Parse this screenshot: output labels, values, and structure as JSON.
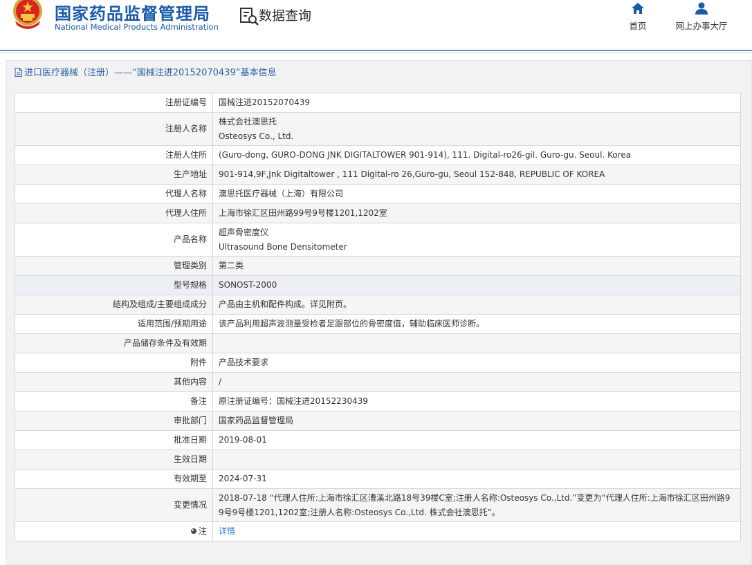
{
  "header": {
    "brand_cn": "国家药品监督管理局",
    "brand_en": "National Medical Products Administration",
    "section_label": "数据查询",
    "nav": [
      {
        "label": "首页",
        "icon": "home-icon"
      },
      {
        "label": "网上办事大厅",
        "icon": "user-icon"
      }
    ]
  },
  "panel": {
    "title": "进口医疗器械（注册）——“国械注进20152070439”基本信息"
  },
  "record": {
    "rows": [
      {
        "key": "注册证编号",
        "lines": [
          "国械注进20152070439"
        ]
      },
      {
        "key": "注册人名称",
        "lines": [
          "株式会社澳思托",
          "Osteosys Co., Ltd."
        ]
      },
      {
        "key": "注册人住所",
        "lines": [
          "(Guro-dong, GURO-DONG JNK DIGITALTOWER 901-914), 111. Digital-ro26-gil. Guro-gu. Seoul. Korea"
        ]
      },
      {
        "key": "生产地址",
        "lines": [
          "901-914,9F,Jnk Digitaltower , 111 Digital-ro 26,Guro-gu, Seoul 152-848, REPUBLIC OF KOREA"
        ]
      },
      {
        "key": "代理人名称",
        "lines": [
          "澳思托医疗器械（上海）有限公司"
        ]
      },
      {
        "key": "代理人住所",
        "lines": [
          "上海市徐汇区田州路99号9号楼1201,1202室"
        ]
      },
      {
        "key": "产品名称",
        "lines": [
          "超声骨密度仪",
          "Ultrasound Bone Densitometer"
        ]
      },
      {
        "key": "管理类别",
        "lines": [
          "第二类"
        ]
      },
      {
        "key": "型号规格",
        "lines": [
          "SONOST-2000"
        ]
      },
      {
        "key": "结构及组成/主要组成成分",
        "lines": [
          "产品由主机和配件构成。详见附页。"
        ]
      },
      {
        "key": "适用范围/预期用途",
        "lines": [
          "该产品利用超声波测量受检者足跟部位的骨密度值，辅助临床医师诊断。"
        ]
      },
      {
        "key": "产品储存条件及有效期",
        "lines": [
          ""
        ]
      },
      {
        "key": "附件",
        "lines": [
          "产品技术要求"
        ]
      },
      {
        "key": "其他内容",
        "lines": [
          "/"
        ]
      },
      {
        "key": "备注",
        "lines": [
          "原注册证编号：国械注进20152230439"
        ]
      },
      {
        "key": "审批部门",
        "lines": [
          "国家药品监督管理局"
        ]
      },
      {
        "key": "批准日期",
        "lines": [
          "2019-08-01"
        ]
      },
      {
        "key": "生效日期",
        "lines": [
          ""
        ]
      },
      {
        "key": "有效期至",
        "lines": [
          "2024-07-31"
        ]
      },
      {
        "key": "变更情况",
        "lines": [
          "2018-07-18 “代理人住所:上海市徐汇区漕溪北路18号39楼C室;注册人名称:Osteosys Co.,Ltd.”变更为“代理人住所:上海市徐汇区田州路99号9号楼1201,1202室;注册人名称:Osteosys Co.,Ltd. 株式会社澳思托”。"
        ]
      },
      {
        "key": "注",
        "lines": [
          "详情"
        ]
      }
    ]
  }
}
